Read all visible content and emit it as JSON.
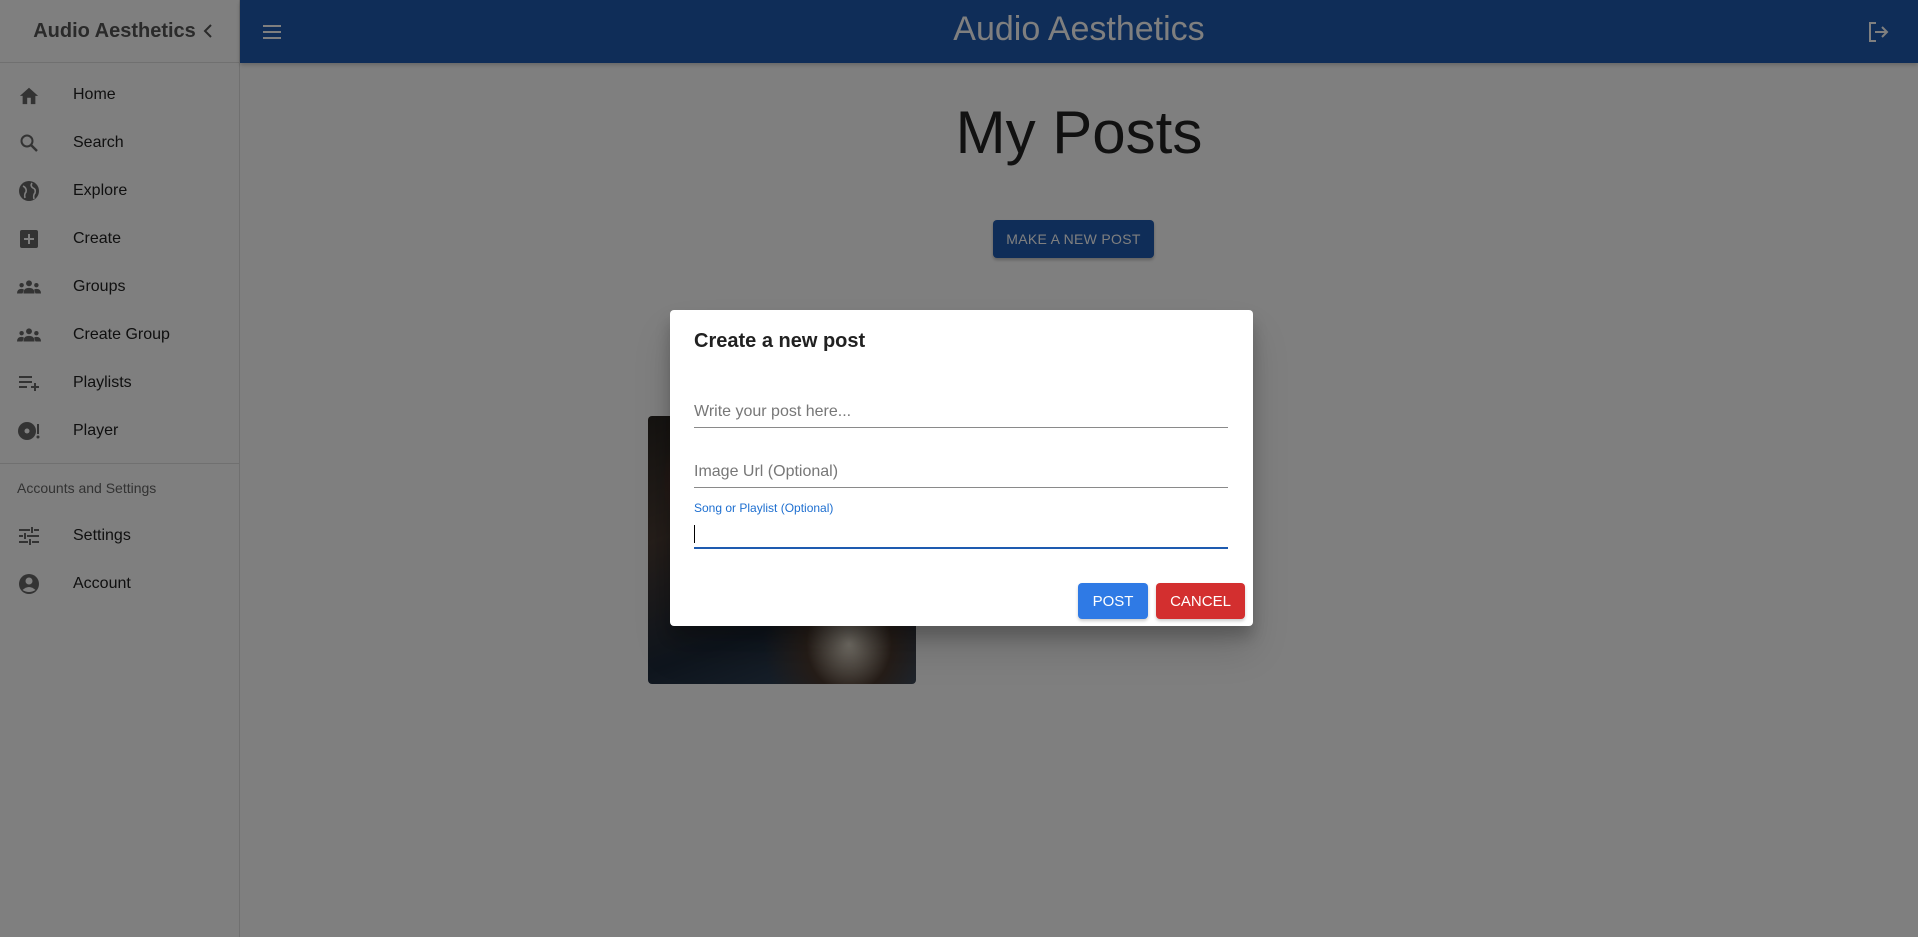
{
  "sidebar": {
    "title": "Audio Aesthetics",
    "items": [
      {
        "label": "Home",
        "icon": "home-icon"
      },
      {
        "label": "Search",
        "icon": "search-icon"
      },
      {
        "label": "Explore",
        "icon": "globe-icon"
      },
      {
        "label": "Create",
        "icon": "add-box-icon"
      },
      {
        "label": "Groups",
        "icon": "groups-icon"
      },
      {
        "label": "Create Group",
        "icon": "groups-icon"
      },
      {
        "label": "Playlists",
        "icon": "playlist-add-icon"
      },
      {
        "label": "Player",
        "icon": "album-icon"
      }
    ],
    "section_header": "Accounts and Settings",
    "settings_items": [
      {
        "label": "Settings",
        "icon": "tune-icon"
      },
      {
        "label": "Account",
        "icon": "account-circle-icon"
      }
    ]
  },
  "topbar": {
    "title": "Audio Aesthetics",
    "color": "#1e5bb0"
  },
  "main": {
    "page_title": "My Posts",
    "new_post_button": "MAKE A NEW POST"
  },
  "dialog": {
    "title": "Create a new post",
    "post_placeholder": "Write your post here...",
    "post_value": "",
    "image_placeholder": "Image Url (Optional)",
    "image_value": "",
    "song_label": "Song or Playlist (Optional)",
    "song_value": "",
    "post_button": "POST",
    "cancel_button": "CANCEL",
    "post_color": "#2f7ae5",
    "cancel_color": "#d32f2f"
  }
}
